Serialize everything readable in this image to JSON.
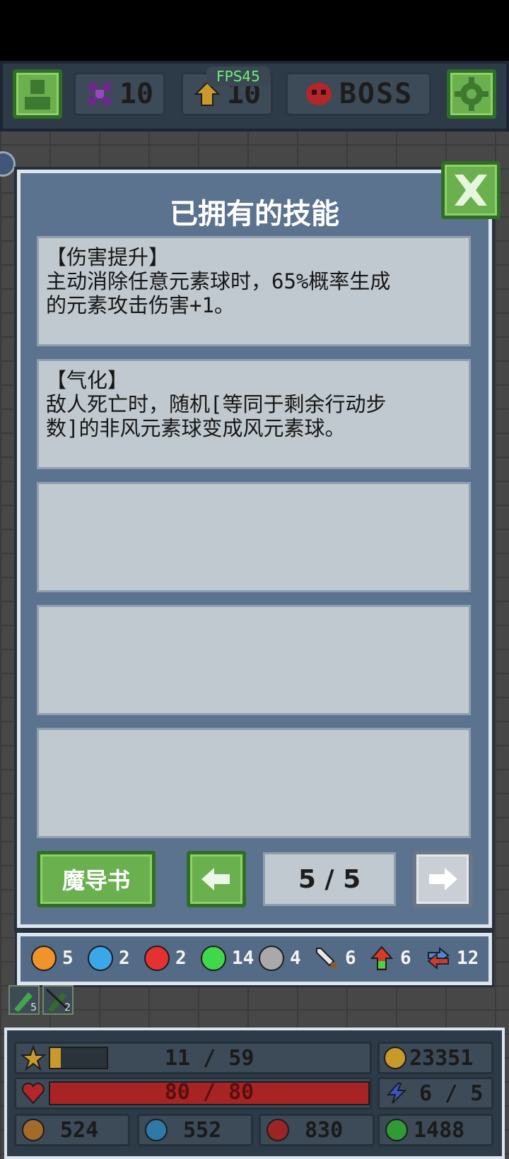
{
  "hud": {
    "fps": "FPS45",
    "gems": "10",
    "upgrades": "10",
    "boss": "BOSS"
  },
  "panel": {
    "title": "已拥有的技能",
    "skills": [
      {
        "text": "【伤害提升】\n主动消除任意元素球时，65%概率生成\n的元素攻击伤害+1。"
      },
      {
        "text": "【气化】\n敌人死亡时，随机[等同于剩余行动步\n数]的非风元素球变成风元素球。"
      },
      {
        "text": ""
      },
      {
        "text": ""
      },
      {
        "text": ""
      }
    ],
    "grimoire_label": "魔导书",
    "page_indicator": "5 / 5"
  },
  "resources": [
    {
      "icon": "orange-orb-icon",
      "color": "#f0932b",
      "count": "5"
    },
    {
      "icon": "blue-orb-icon",
      "color": "#3aa8e8",
      "count": "2"
    },
    {
      "icon": "red-orb-icon",
      "color": "#e43232",
      "count": "2"
    },
    {
      "icon": "green-orb-icon",
      "color": "#3fd84a",
      "count": "14"
    },
    {
      "icon": "gray-orb-icon",
      "color": "#a9a9a9",
      "count": "4"
    },
    {
      "icon": "sword-icon",
      "color": "#dcdcdc",
      "count": "6"
    },
    {
      "icon": "attack-up-icon",
      "color": "#d83a2a",
      "count": "6"
    },
    {
      "icon": "swap-icon",
      "color": "#4c8ad8",
      "count": "12"
    }
  ],
  "small_items": [
    {
      "icon": "green-skill-icon",
      "count": "5"
    },
    {
      "icon": "dark-skill-icon",
      "count": "2"
    }
  ],
  "player": {
    "exp": "11 / 59",
    "exp_fraction": 0.19,
    "gold": "23351",
    "hp": "80 / 80",
    "hp_fraction": 1.0,
    "energy": "6 / 5",
    "orange_total": "524",
    "blue_total": "552",
    "red_total": "830",
    "green_total": "1488"
  }
}
